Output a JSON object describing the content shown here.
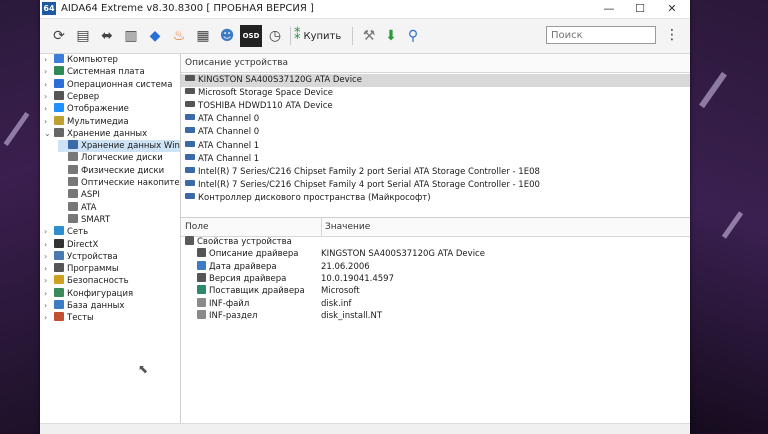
{
  "window": {
    "app_icon": "64",
    "title": "AIDA64 Extreme v8.30.8300  [ ПРОБНАЯ ВЕРСИЯ ]",
    "controls": {
      "minimize": "—",
      "maximize": "☐",
      "close": "✕"
    }
  },
  "toolbar": {
    "icons": [
      "refresh-icon",
      "report-icon",
      "hardware-icon",
      "memory-icon",
      "network-icon",
      "flame-icon",
      "benchmark-icon",
      "user-icon",
      "osd-icon",
      "clock-icon"
    ],
    "buy_label": "Купить",
    "search_placeholder": "Поиск"
  },
  "tree": {
    "items": [
      {
        "label": "Компьютер",
        "icon_color": "#3b7dd8",
        "expander": "›"
      },
      {
        "label": "Системная плата",
        "icon_color": "#2e8b57",
        "expander": "›"
      },
      {
        "label": "Операционная система",
        "icon_color": "#2b6fd6",
        "expander": "›"
      },
      {
        "label": "Сервер",
        "icon_color": "#555555",
        "expander": "›"
      },
      {
        "label": "Отображение",
        "icon_color": "#1e90ff",
        "expander": "›"
      },
      {
        "label": "Мультимедиа",
        "icon_color": "#c0a030",
        "expander": "›"
      },
      {
        "label": "Хранение данных",
        "icon_color": "#666666",
        "expander": "⌄"
      },
      {
        "label": "Хранение данных Wind",
        "icon_color": "#3c6aa8",
        "expander": ""
      },
      {
        "label": "Логические диски",
        "icon_color": "#777777",
        "expander": ""
      },
      {
        "label": "Физические диски",
        "icon_color": "#777777",
        "expander": ""
      },
      {
        "label": "Оптические накопители",
        "icon_color": "#777777",
        "expander": ""
      },
      {
        "label": "ASPI",
        "icon_color": "#777777",
        "expander": ""
      },
      {
        "label": "ATA",
        "icon_color": "#777777",
        "expander": ""
      },
      {
        "label": "SMART",
        "icon_color": "#777777",
        "expander": ""
      },
      {
        "label": "Сеть",
        "icon_color": "#2d8fd0",
        "expander": "›"
      },
      {
        "label": "DirectX",
        "icon_color": "#333333",
        "expander": "›"
      },
      {
        "label": "Устройства",
        "icon_color": "#4a78b0",
        "expander": "›"
      },
      {
        "label": "Программы",
        "icon_color": "#555555",
        "expander": "›"
      },
      {
        "label": "Безопасность",
        "icon_color": "#d0a020",
        "expander": "›"
      },
      {
        "label": "Конфигурация",
        "icon_color": "#3a8a5a",
        "expander": "›"
      },
      {
        "label": "База данных",
        "icon_color": "#3d7cc4",
        "expander": "›"
      },
      {
        "label": "Тесты",
        "icon_color": "#c05030",
        "expander": "›"
      }
    ]
  },
  "devices": {
    "header": "Описание устройства",
    "rows": [
      {
        "label": "KINGSTON SA400S37120G ATA Device",
        "kind": "drive",
        "selected": true
      },
      {
        "label": "Microsoft Storage Space Device",
        "kind": "drive",
        "selected": false
      },
      {
        "label": "TOSHIBA HDWD110 ATA Device",
        "kind": "drive",
        "selected": false
      },
      {
        "label": "ATA Channel 0",
        "kind": "ctl",
        "selected": false
      },
      {
        "label": "ATA Channel 0",
        "kind": "ctl",
        "selected": false
      },
      {
        "label": "ATA Channel 1",
        "kind": "ctl",
        "selected": false
      },
      {
        "label": "ATA Channel 1",
        "kind": "ctl",
        "selected": false
      },
      {
        "label": "Intel(R) 7 Series/C216 Chipset Family 2 port Serial ATA Storage Controller - 1E08",
        "kind": "ctl",
        "selected": false
      },
      {
        "label": "Intel(R) 7 Series/C216 Chipset Family 4 port Serial ATA Storage Controller - 1E00",
        "kind": "ctl",
        "selected": false
      },
      {
        "label": "Контроллер дискового пространства (Майкрософт)",
        "kind": "ctl",
        "selected": false
      }
    ]
  },
  "properties": {
    "col_field": "Поле",
    "col_value": "Значение",
    "rows": [
      {
        "field": "Свойства устройства",
        "value": "",
        "group": true,
        "icon_color": "#5a5a5a"
      },
      {
        "field": "Описание драйвера",
        "value": "KINGSTON SA400S37120G ATA Device",
        "group": false,
        "icon_color": "#555555"
      },
      {
        "field": "Дата драйвера",
        "value": "21.06.2006",
        "group": false,
        "icon_color": "#3d7cc4"
      },
      {
        "field": "Версия драйвера",
        "value": "10.0.19041.4597",
        "group": false,
        "icon_color": "#555555"
      },
      {
        "field": "Поставщик драйвера",
        "value": "Microsoft",
        "group": false,
        "icon_color": "#2a8a6a"
      },
      {
        "field": "INF-файл",
        "value": "disk.inf",
        "group": false,
        "icon_color": "#8a8a8a"
      },
      {
        "field": "INF-раздел",
        "value": "disk_install.NT",
        "group": false,
        "icon_color": "#8a8a8a"
      }
    ]
  }
}
